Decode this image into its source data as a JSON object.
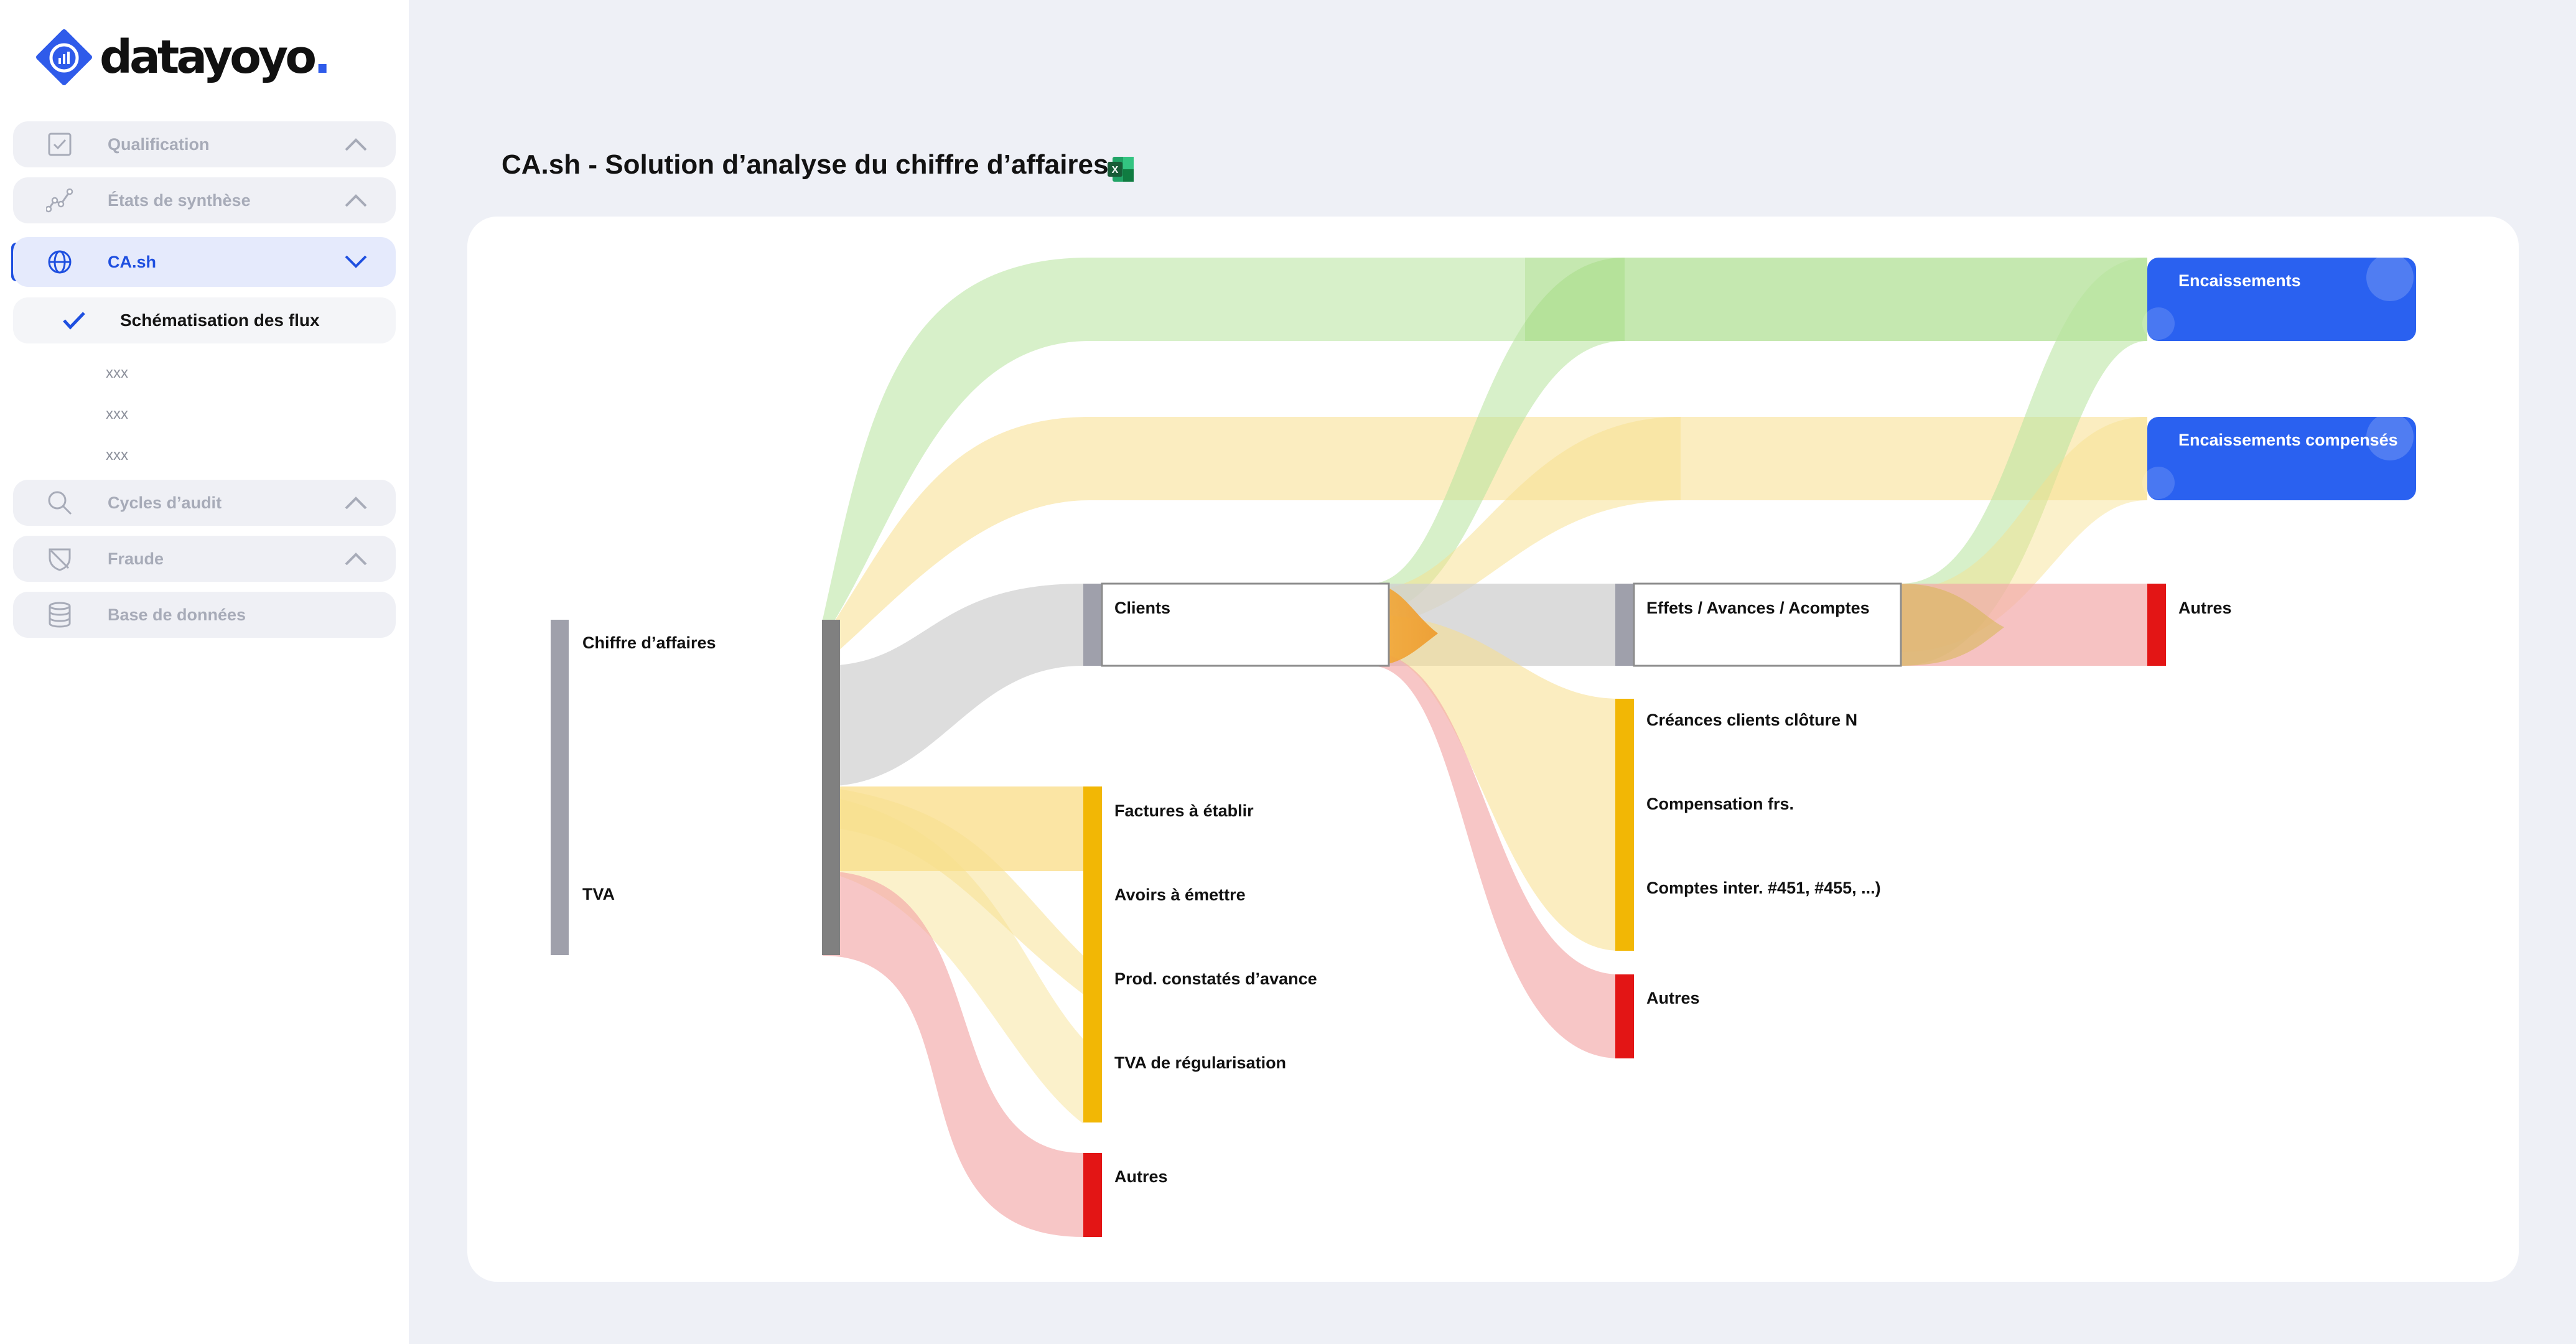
{
  "brand": {
    "name": "datayoyo",
    "dot": "."
  },
  "sidebar": {
    "items": [
      {
        "label": "Qualification",
        "icon": "checkbox-icon",
        "expanded": false
      },
      {
        "label": "États de synthèse",
        "icon": "line-chart-icon",
        "expanded": false
      },
      {
        "label": "CA.sh",
        "icon": "globe-icon",
        "expanded": true,
        "active": true
      },
      {
        "label": "Cycles d’audit",
        "icon": "search-icon",
        "expanded": false
      },
      {
        "label": "Fraude",
        "icon": "shield-icon",
        "expanded": false
      },
      {
        "label": "Base de données",
        "icon": "database-icon"
      }
    ],
    "sub_item": {
      "label": "Schématisation des flux",
      "icon": "check-icon"
    },
    "sub_sub_items": [
      "xxx",
      "xxx",
      "xxx"
    ]
  },
  "main": {
    "title": "CA.sh - Solution d’analyse du chiffre d’affaires",
    "export_icon": "excel-icon"
  },
  "colors": {
    "accent": "#1e4fe0",
    "node_gray": "#9fa0ab",
    "node_dark": "#808080",
    "node_yellow": "#f2b705",
    "node_red": "#e31515",
    "node_blue": "#2a61f0",
    "flow_green": "#b6e39c",
    "flow_yellow": "#f7df8c",
    "flow_gray": "#cfcfcf",
    "flow_red": "#f2a8a8"
  },
  "diagram": {
    "nodes": {
      "chiffre": "Chiffre d’affaires",
      "tva": "TVA",
      "clients": "Clients",
      "factures": "Factures à établir",
      "avoirs": "Avoirs à émettre",
      "prod": "Prod. constatés d’avance",
      "tvareg": "TVA de régularisation",
      "autres1": "Autres",
      "effets": "Effets / Avances / Acomptes",
      "creances": "Créances clients clôture N",
      "compensation": "Compensation frs.",
      "comptes": "Comptes inter. #451, #455, ...)",
      "autres2": "Autres",
      "encaissements": "Encaissements",
      "enc_comp": "Encaissements compensés",
      "autres3": "Autres"
    }
  }
}
